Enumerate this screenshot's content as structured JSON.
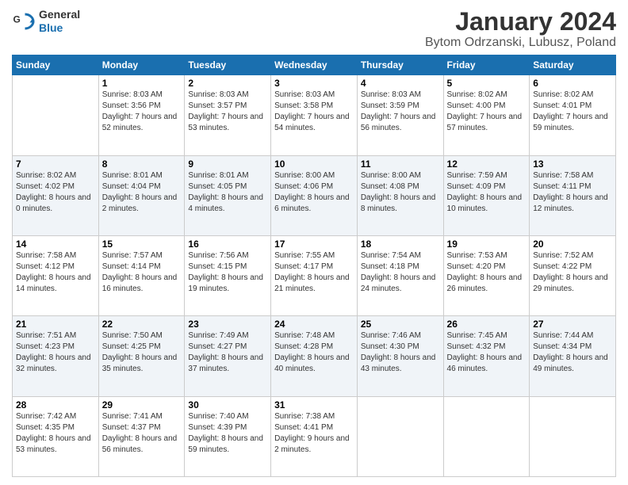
{
  "logo": {
    "general": "General",
    "blue": "Blue"
  },
  "title": "January 2024",
  "subtitle": "Bytom Odrzanski, Lubusz, Poland",
  "weekdays": [
    "Sunday",
    "Monday",
    "Tuesday",
    "Wednesday",
    "Thursday",
    "Friday",
    "Saturday"
  ],
  "weeks": [
    [
      {
        "day": "",
        "sunrise": "",
        "sunset": "",
        "daylight": ""
      },
      {
        "day": "1",
        "sunrise": "Sunrise: 8:03 AM",
        "sunset": "Sunset: 3:56 PM",
        "daylight": "Daylight: 7 hours and 52 minutes."
      },
      {
        "day": "2",
        "sunrise": "Sunrise: 8:03 AM",
        "sunset": "Sunset: 3:57 PM",
        "daylight": "Daylight: 7 hours and 53 minutes."
      },
      {
        "day": "3",
        "sunrise": "Sunrise: 8:03 AM",
        "sunset": "Sunset: 3:58 PM",
        "daylight": "Daylight: 7 hours and 54 minutes."
      },
      {
        "day": "4",
        "sunrise": "Sunrise: 8:03 AM",
        "sunset": "Sunset: 3:59 PM",
        "daylight": "Daylight: 7 hours and 56 minutes."
      },
      {
        "day": "5",
        "sunrise": "Sunrise: 8:02 AM",
        "sunset": "Sunset: 4:00 PM",
        "daylight": "Daylight: 7 hours and 57 minutes."
      },
      {
        "day": "6",
        "sunrise": "Sunrise: 8:02 AM",
        "sunset": "Sunset: 4:01 PM",
        "daylight": "Daylight: 7 hours and 59 minutes."
      }
    ],
    [
      {
        "day": "7",
        "sunrise": "Sunrise: 8:02 AM",
        "sunset": "Sunset: 4:02 PM",
        "daylight": "Daylight: 8 hours and 0 minutes."
      },
      {
        "day": "8",
        "sunrise": "Sunrise: 8:01 AM",
        "sunset": "Sunset: 4:04 PM",
        "daylight": "Daylight: 8 hours and 2 minutes."
      },
      {
        "day": "9",
        "sunrise": "Sunrise: 8:01 AM",
        "sunset": "Sunset: 4:05 PM",
        "daylight": "Daylight: 8 hours and 4 minutes."
      },
      {
        "day": "10",
        "sunrise": "Sunrise: 8:00 AM",
        "sunset": "Sunset: 4:06 PM",
        "daylight": "Daylight: 8 hours and 6 minutes."
      },
      {
        "day": "11",
        "sunrise": "Sunrise: 8:00 AM",
        "sunset": "Sunset: 4:08 PM",
        "daylight": "Daylight: 8 hours and 8 minutes."
      },
      {
        "day": "12",
        "sunrise": "Sunrise: 7:59 AM",
        "sunset": "Sunset: 4:09 PM",
        "daylight": "Daylight: 8 hours and 10 minutes."
      },
      {
        "day": "13",
        "sunrise": "Sunrise: 7:58 AM",
        "sunset": "Sunset: 4:11 PM",
        "daylight": "Daylight: 8 hours and 12 minutes."
      }
    ],
    [
      {
        "day": "14",
        "sunrise": "Sunrise: 7:58 AM",
        "sunset": "Sunset: 4:12 PM",
        "daylight": "Daylight: 8 hours and 14 minutes."
      },
      {
        "day": "15",
        "sunrise": "Sunrise: 7:57 AM",
        "sunset": "Sunset: 4:14 PM",
        "daylight": "Daylight: 8 hours and 16 minutes."
      },
      {
        "day": "16",
        "sunrise": "Sunrise: 7:56 AM",
        "sunset": "Sunset: 4:15 PM",
        "daylight": "Daylight: 8 hours and 19 minutes."
      },
      {
        "day": "17",
        "sunrise": "Sunrise: 7:55 AM",
        "sunset": "Sunset: 4:17 PM",
        "daylight": "Daylight: 8 hours and 21 minutes."
      },
      {
        "day": "18",
        "sunrise": "Sunrise: 7:54 AM",
        "sunset": "Sunset: 4:18 PM",
        "daylight": "Daylight: 8 hours and 24 minutes."
      },
      {
        "day": "19",
        "sunrise": "Sunrise: 7:53 AM",
        "sunset": "Sunset: 4:20 PM",
        "daylight": "Daylight: 8 hours and 26 minutes."
      },
      {
        "day": "20",
        "sunrise": "Sunrise: 7:52 AM",
        "sunset": "Sunset: 4:22 PM",
        "daylight": "Daylight: 8 hours and 29 minutes."
      }
    ],
    [
      {
        "day": "21",
        "sunrise": "Sunrise: 7:51 AM",
        "sunset": "Sunset: 4:23 PM",
        "daylight": "Daylight: 8 hours and 32 minutes."
      },
      {
        "day": "22",
        "sunrise": "Sunrise: 7:50 AM",
        "sunset": "Sunset: 4:25 PM",
        "daylight": "Daylight: 8 hours and 35 minutes."
      },
      {
        "day": "23",
        "sunrise": "Sunrise: 7:49 AM",
        "sunset": "Sunset: 4:27 PM",
        "daylight": "Daylight: 8 hours and 37 minutes."
      },
      {
        "day": "24",
        "sunrise": "Sunrise: 7:48 AM",
        "sunset": "Sunset: 4:28 PM",
        "daylight": "Daylight: 8 hours and 40 minutes."
      },
      {
        "day": "25",
        "sunrise": "Sunrise: 7:46 AM",
        "sunset": "Sunset: 4:30 PM",
        "daylight": "Daylight: 8 hours and 43 minutes."
      },
      {
        "day": "26",
        "sunrise": "Sunrise: 7:45 AM",
        "sunset": "Sunset: 4:32 PM",
        "daylight": "Daylight: 8 hours and 46 minutes."
      },
      {
        "day": "27",
        "sunrise": "Sunrise: 7:44 AM",
        "sunset": "Sunset: 4:34 PM",
        "daylight": "Daylight: 8 hours and 49 minutes."
      }
    ],
    [
      {
        "day": "28",
        "sunrise": "Sunrise: 7:42 AM",
        "sunset": "Sunset: 4:35 PM",
        "daylight": "Daylight: 8 hours and 53 minutes."
      },
      {
        "day": "29",
        "sunrise": "Sunrise: 7:41 AM",
        "sunset": "Sunset: 4:37 PM",
        "daylight": "Daylight: 8 hours and 56 minutes."
      },
      {
        "day": "30",
        "sunrise": "Sunrise: 7:40 AM",
        "sunset": "Sunset: 4:39 PM",
        "daylight": "Daylight: 8 hours and 59 minutes."
      },
      {
        "day": "31",
        "sunrise": "Sunrise: 7:38 AM",
        "sunset": "Sunset: 4:41 PM",
        "daylight": "Daylight: 9 hours and 2 minutes."
      },
      {
        "day": "",
        "sunrise": "",
        "sunset": "",
        "daylight": ""
      },
      {
        "day": "",
        "sunrise": "",
        "sunset": "",
        "daylight": ""
      },
      {
        "day": "",
        "sunrise": "",
        "sunset": "",
        "daylight": ""
      }
    ]
  ]
}
